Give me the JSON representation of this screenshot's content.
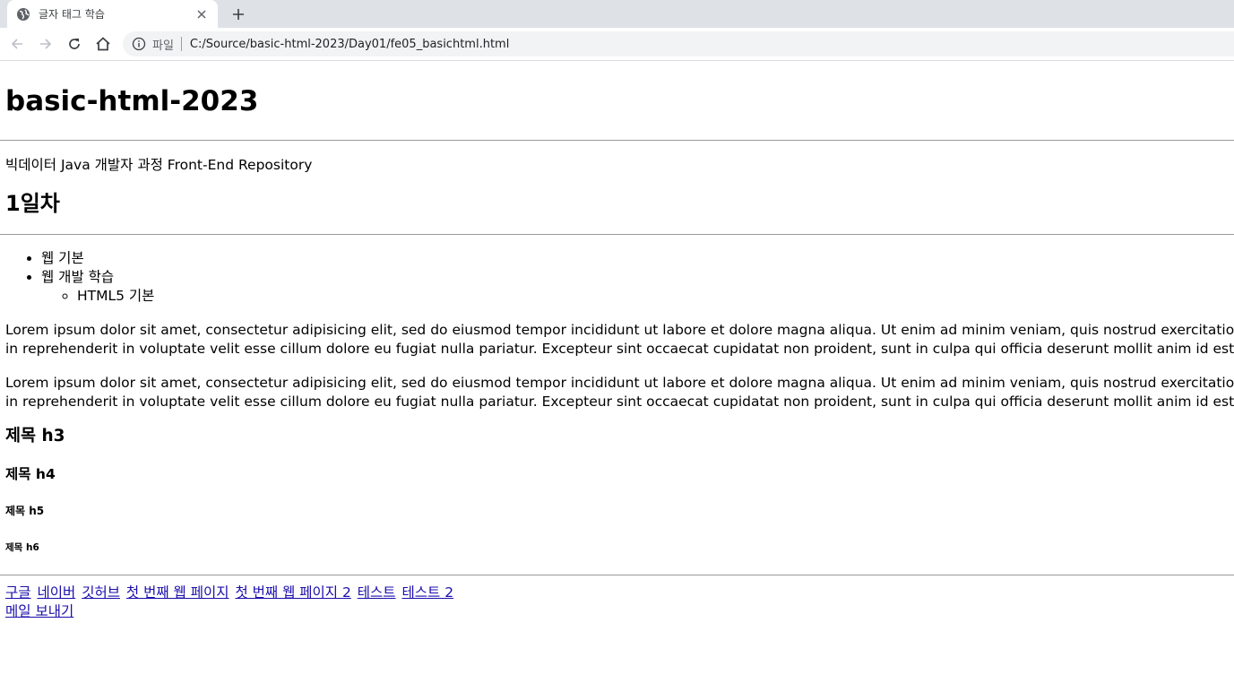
{
  "browser": {
    "tab_title": "글자 태그 학습",
    "scheme_label": "파일",
    "url": "C:/Source/basic-html-2023/Day01/fe05_basichtml.html",
    "icons": {
      "tab": "globe-icon",
      "close": "close-icon",
      "new_tab": "plus-icon",
      "back": "back-arrow-icon",
      "forward": "forward-arrow-icon",
      "reload": "reload-icon",
      "home": "home-icon",
      "info": "info-icon"
    }
  },
  "page": {
    "title": "basic-html-2023",
    "subtitle": "빅데이터 Java 개발자 과정 Front-End Repository",
    "day_heading": "1일차",
    "list": {
      "item1": "웹 기본",
      "item2": "웹 개발 학습",
      "subitem1": "HTML5 기본"
    },
    "paragraph1": {
      "line1": "Lorem ipsum dolor sit amet, consectetur adipisicing elit, sed do eiusmod tempor incididunt ut labore et dolore magna aliqua. Ut enim ad minim veniam, quis nostrud exercitation ullamco",
      "line2": "in reprehenderit in voluptate velit esse cillum dolore eu fugiat nulla pariatur. Excepteur sint occaecat cupidatat non proident, sunt in culpa qui officia deserunt mollit anim id est laborum."
    },
    "paragraph2": {
      "line1": "Lorem ipsum dolor sit amet, consectetur adipisicing elit, sed do eiusmod tempor incididunt ut labore et dolore magna aliqua. Ut enim ad minim veniam, quis nostrud exercitation ullamco",
      "line2": "in reprehenderit in voluptate velit esse cillum dolore eu fugiat nulla pariatur. Excepteur sint occaecat cupidatat non proident, sunt in culpa qui officia deserunt mollit anim id est laborum."
    },
    "h3": "제목 h3",
    "h4": "제목 h4",
    "h5": "제목 h5",
    "h6": "제목 h6",
    "links": {
      "google": "구글",
      "naver": "네이버",
      "github": "깃허브",
      "first_page": "첫 번째 웹 페이지",
      "first_page_2": "첫 번째 웹 페이지 2",
      "test": "테스트",
      "test_2": "테스트 2",
      "mail": "메일 보내기"
    },
    "link_color": "#1a0dab",
    "visited_link_color": "#551a8b"
  }
}
